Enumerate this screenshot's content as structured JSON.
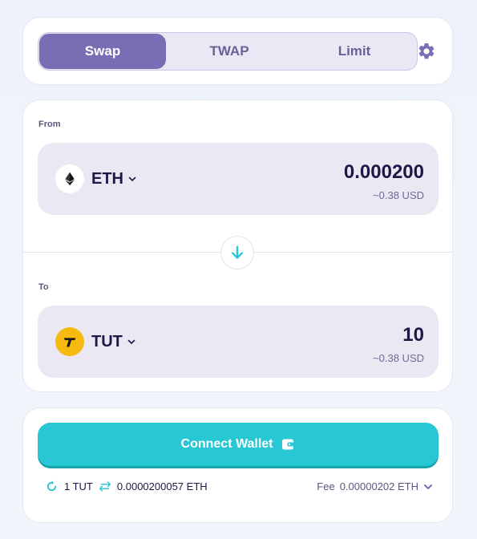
{
  "tabs": {
    "items": [
      {
        "label": "Swap",
        "active": true
      },
      {
        "label": "TWAP",
        "active": false
      },
      {
        "label": "Limit",
        "active": false
      }
    ],
    "settings_icon": "gear-icon"
  },
  "swap": {
    "from": {
      "label": "From",
      "token_symbol": "ETH",
      "token_icon": "ethereum-icon",
      "amount": "0.000200",
      "usd": "~0.38 USD"
    },
    "to": {
      "label": "To",
      "token_symbol": "TUT",
      "token_icon": "tut-token-icon",
      "amount": "10",
      "usd": "~0.38 USD"
    },
    "switch_icon": "arrow-down-icon"
  },
  "wallet": {
    "connect_label": "Connect Wallet",
    "rate_left": "1 TUT",
    "rate_right": "0.0000200057 ETH",
    "fee_label": "Fee",
    "fee_value": "0.00000202 ETH"
  },
  "colors": {
    "accent": "#7a6db3",
    "primary_button": "#27c7d4",
    "text": "#1f1847",
    "tut_yellow": "#f6b90f"
  }
}
